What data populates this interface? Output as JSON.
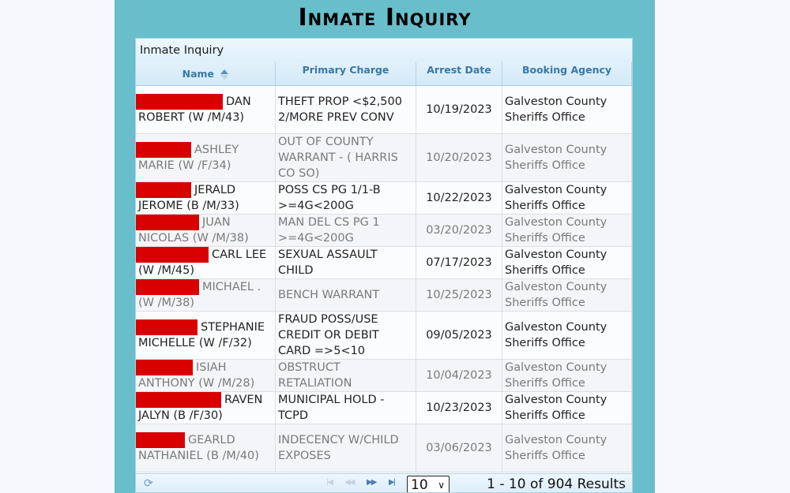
{
  "page": {
    "title": "Inmate Inquiry"
  },
  "grid": {
    "caption": "Inmate Inquiry",
    "columns": [
      {
        "label": "Name",
        "sorted": "ascending"
      },
      {
        "label": "Primary Charge"
      },
      {
        "label": "Arrest Date"
      },
      {
        "label": "Booking Agency"
      }
    ],
    "rows": [
      {
        "name": "DAN ROBERT (W /M/43)",
        "charge": "THEFT PROP <$2,500 2/MORE PREV CONV",
        "arrest_date": "10/19/2023",
        "agency": "Galveston County Sheriffs Office"
      },
      {
        "name": "ASHLEY MARIE (W /F/34)",
        "charge": "OUT OF COUNTY WARRANT - ( HARRIS CO SO)",
        "arrest_date": "10/20/2023",
        "agency": "Galveston County Sheriffs Office"
      },
      {
        "name": "JERALD JEROME (B /M/33)",
        "charge": "POSS CS PG 1/1-B >=4G<200G",
        "arrest_date": "10/22/2023",
        "agency": "Galveston County Sheriffs Office"
      },
      {
        "name": "JUAN NICOLAS (W /M/38)",
        "charge": "MAN DEL CS PG 1 >=4G<200G",
        "arrest_date": "03/20/2023",
        "agency": "Galveston County Sheriffs Office"
      },
      {
        "name": "CARL LEE (W /M/45)",
        "charge": "SEXUAL ASSAULT CHILD",
        "arrest_date": "07/17/2023",
        "agency": "Galveston County Sheriffs Office"
      },
      {
        "name": "MICHAEL . (W /M/38)",
        "charge": "BENCH WARRANT",
        "arrest_date": "10/25/2023",
        "agency": "Galveston County Sheriffs Office"
      },
      {
        "name": "STEPHANIE MICHELLE (W /F/32)",
        "charge": "FRAUD POSS/USE CREDIT OR DEBIT CARD =>5<10",
        "arrest_date": "09/05/2023",
        "agency": "Galveston County Sheriffs Office"
      },
      {
        "name": "ISIAH ANTHONY (W /M/28)",
        "charge": "OBSTRUCT RETALIATION",
        "arrest_date": "10/04/2023",
        "agency": "Galveston County Sheriffs Office"
      },
      {
        "name": "RAVEN JALYN (B /F/30)",
        "charge": "MUNICIPAL HOLD - TCPD",
        "arrest_date": "10/23/2023",
        "agency": "Galveston County Sheriffs Office"
      },
      {
        "name": "GEARLD NATHANIEL (B /M/40)",
        "charge": "INDECENCY W/CHILD EXPOSES",
        "arrest_date": "03/06/2023",
        "agency": "Galveston County Sheriffs Office"
      }
    ]
  },
  "pager": {
    "refresh_icon": "refresh-icon",
    "first_icon": "first-page-icon",
    "prev_icon": "prev-page-icon",
    "next_icon": "next-page-icon",
    "last_icon": "last-page-icon",
    "page_size": "10",
    "results_text": "1 - 10 of 904 Results"
  },
  "colors": {
    "background_accent": "#68bfcb",
    "redaction": "#d90000",
    "header_text": "#3a78a6"
  }
}
